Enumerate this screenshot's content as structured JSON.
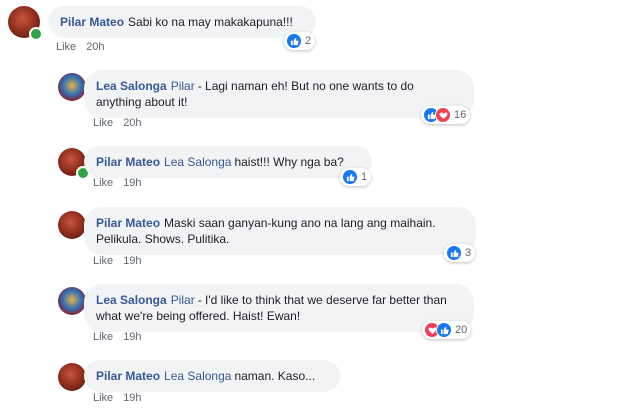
{
  "comments": [
    {
      "author": "Pilar Mateo",
      "mention": "",
      "text": "Sabi ko na may makakapuna!!!",
      "like": "Like",
      "time": "20h",
      "reactions": [
        "like"
      ],
      "reaction_count": "2"
    },
    {
      "author": "Lea Salonga",
      "mention": "Pilar",
      "text": "- Lagi naman eh! But no one wants to do anything about it!",
      "like": "Like",
      "time": "20h",
      "reactions": [
        "like",
        "love"
      ],
      "reaction_count": "16"
    },
    {
      "author": "Pilar Mateo",
      "mention": "Lea Salonga",
      "text": "haist!!! Why nga ba?",
      "like": "Like",
      "time": "19h",
      "reactions": [
        "like"
      ],
      "reaction_count": "1"
    },
    {
      "author": "Pilar Mateo",
      "mention": "",
      "text": "Maski saan ganyan-kung ano na lang ang maihain. Pelikula. Shows. Pulitika.",
      "like": "Like",
      "time": "19h",
      "reactions": [
        "like"
      ],
      "reaction_count": "3"
    },
    {
      "author": "Lea Salonga",
      "mention": "Pilar",
      "text": "- I'd like to think that we deserve far better than what we're being offered. Haist! Ewan!",
      "like": "Like",
      "time": "19h",
      "reactions": [
        "love",
        "like"
      ],
      "reaction_count": "20"
    },
    {
      "author": "Pilar Mateo",
      "mention": "Lea Salonga",
      "text": "naman. Kaso...",
      "like": "Like",
      "time": "19h",
      "reactions": [],
      "reaction_count": ""
    }
  ],
  "colors": {
    "author": "#385898",
    "like_reaction": "#1877f2",
    "love_reaction": "#f33e58",
    "bubble": "#f2f3f5",
    "online": "#31a24c"
  }
}
